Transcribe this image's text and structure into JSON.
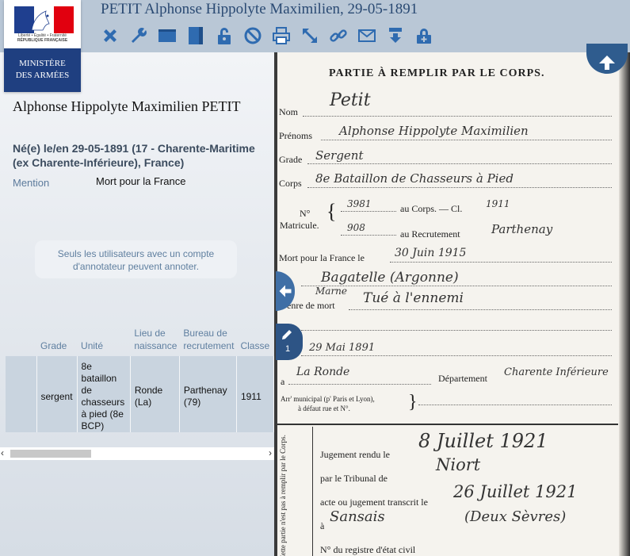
{
  "window": {
    "title": "PETIT Alphonse Hippolyte Maximilien, 29-05-1891"
  },
  "logo": {
    "motto": "Liberté • Égalité • Fraternité",
    "republic": "RÉPUBLIQUE FRANÇAISE",
    "ministry_line1": "MINISTÈRE",
    "ministry_line2": "DES ARMÉES"
  },
  "toolbar": {
    "icons": [
      "close-icon",
      "wrench-icon",
      "layout-horizontal-icon",
      "layout-vertical-icon",
      "lock-icon",
      "forbidden-icon",
      "print-icon",
      "expand-icon",
      "link-icon",
      "email-icon",
      "download-icon",
      "lock-add-icon"
    ]
  },
  "person": {
    "name": "Alphonse Hippolyte Maximilien PETIT",
    "birth": "Né(e) le/en 29-05-1891 (17 - Charente-Maritime (ex Charente-Inférieure), France)",
    "mention_label": "Mention",
    "mention_value": "Mort pour la France"
  },
  "annotation_notice": "Seuls les utilisateurs avec un compte d'annotateur peuvent annoter.",
  "details_table": {
    "headers": [
      "",
      "Grade",
      "Unité",
      "Lieu de naissance",
      "Bureau de recrutement",
      "Classe"
    ],
    "row": [
      "",
      "sergent",
      "8e bataillon de chasseurs à pied (8e BCP)",
      "Ronde (La)",
      "Parthenay (79)",
      "1911"
    ]
  },
  "document": {
    "heading": "PARTIE À REMPLIR PAR LE CORPS.",
    "labels": {
      "nom": "Nom",
      "prenoms": "Prénoms",
      "grade": "Grade",
      "corps": "Corps",
      "no": "N°",
      "matricule": "Matricule.",
      "au_corps": "au Corps. — Cl.",
      "au_recrutement": "au Recrutement",
      "mort": "Mort pour la France le",
      "genre": "enre de mort",
      "a": "a",
      "departement": "Département",
      "arr": "Arr' municipal (p' Paris et Lyon),",
      "arr2": "à défaut rue et N°.",
      "jugement": "Jugement rendu le",
      "tribunal": "par le Tribunal de",
      "transcrit": "acte ou jugement transcrit le",
      "a2": "à",
      "registre": "N° du registre d'état civil",
      "fold": "Cette partie n'est pas à remplir par le Corps."
    },
    "handwritten": {
      "nom": "Petit",
      "prenoms": "Alphonse Hippolyte Maximilien",
      "grade": "Sergent",
      "corps": "8e Bataillon de Chasseurs à Pied",
      "matricule_corps": "3981",
      "classe": "1911",
      "matricule_rec": "908",
      "recrutement": "Parthenay",
      "mort_date": "30 Juin 1915",
      "lieu": "Bagatelle (Argonne)",
      "marne": "Marne",
      "genre": "Tué à l'ennemi",
      "naissance": "29 Mai 1891",
      "commune": "La Ronde",
      "departement": "Charente Inférieure",
      "jugement": "8 Juillet 1921",
      "tribunal": "Niort",
      "transcrit": "26 Juillet 1921",
      "a2": "Sansais",
      "a2b": "(Deux Sèvres)"
    }
  },
  "overlay": {
    "annotation_count": "1"
  }
}
